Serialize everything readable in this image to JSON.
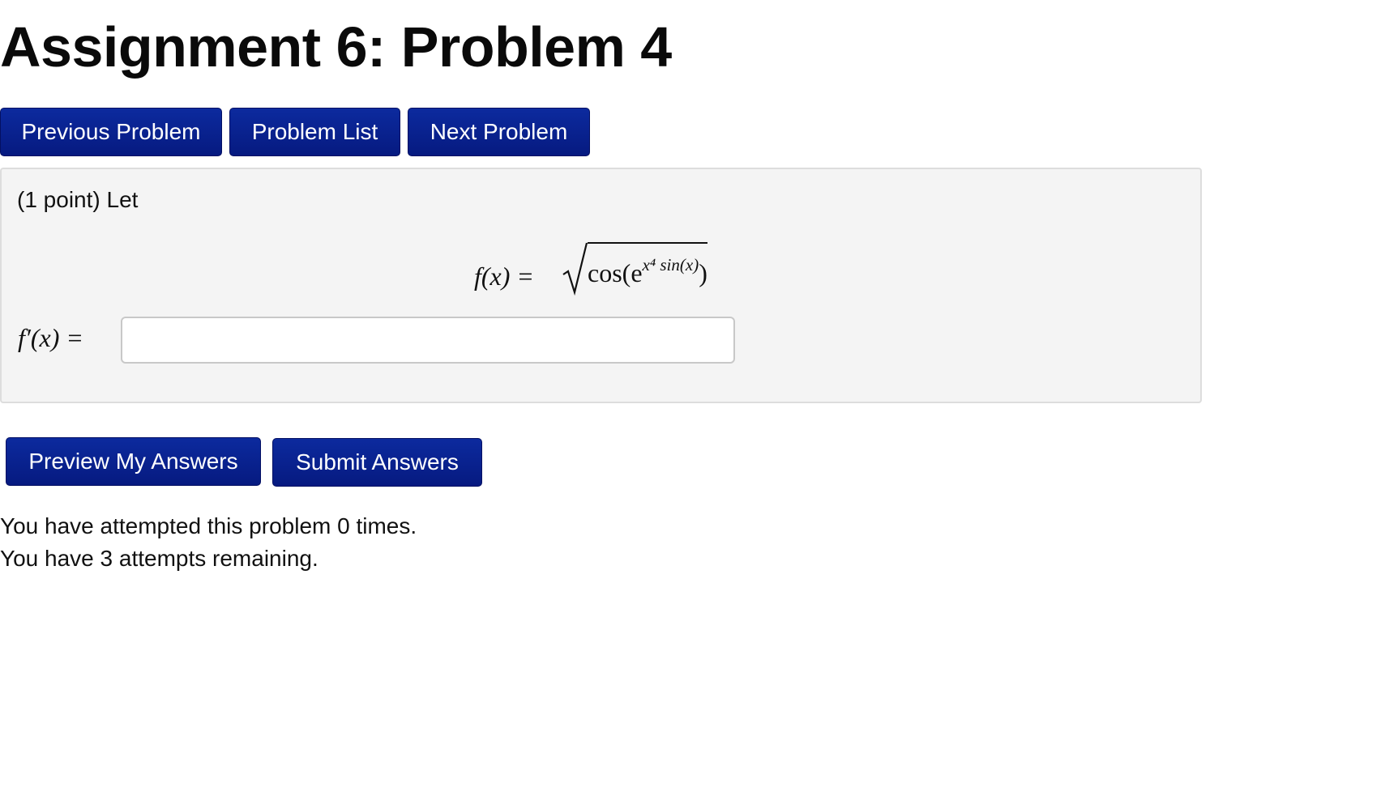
{
  "page": {
    "title": "Assignment 6: Problem 4"
  },
  "nav": {
    "previous_label": "Previous Problem",
    "list_label": "Problem List",
    "next_label": "Next Problem"
  },
  "problem": {
    "intro": "(1 point) Let",
    "equation": {
      "lhs": "f(x) =",
      "radicand_base": "cos(e",
      "exponent": "x⁴ sin(x)",
      "radicand_close": ")"
    },
    "answer_label": "f′(x) =",
    "answer_value": "",
    "answer_placeholder": ""
  },
  "actions": {
    "preview_label": "Preview My Answers",
    "submit_label": "Submit Answers"
  },
  "status": {
    "attempted": "You have attempted this problem 0 times.",
    "remaining": "You have 3 attempts remaining."
  },
  "colors": {
    "button_bg": "#061a80",
    "box_bg": "#f4f4f4"
  }
}
